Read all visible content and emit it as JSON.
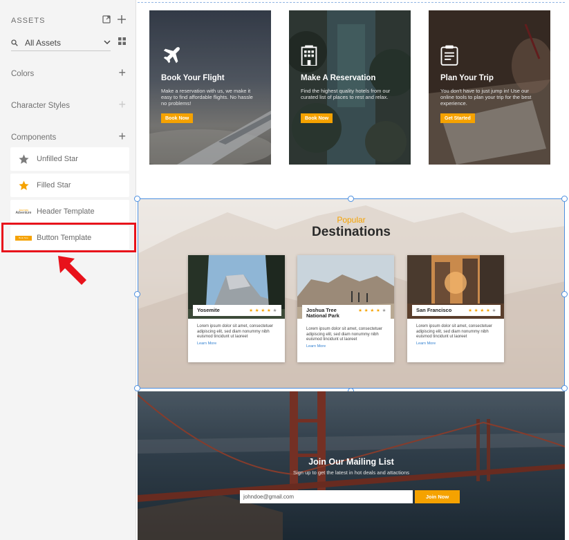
{
  "sidebar": {
    "header": "ASSETS",
    "search_label": "All Assets",
    "sections": {
      "colors": "Colors",
      "character_styles": "Character Styles",
      "components": "Components"
    },
    "components": [
      {
        "label": "Unfilled Star",
        "icon": "star-outline-icon"
      },
      {
        "label": "Filled Star",
        "icon": "star-filled-icon"
      },
      {
        "label": "Header Template",
        "icon": "header-thumbnail"
      },
      {
        "label": "Button Template",
        "icon": "button-thumbnail"
      }
    ],
    "mini_header_text": {
      "top": "Journey",
      "main": "Adventure"
    },
    "mini_button_text": "Book Now"
  },
  "hero_cards": [
    {
      "title": "Book Your Flight",
      "desc": "Make a reservation with us, we make it easy to find affordable flights. No hassle no problems!",
      "button": "Book Now",
      "icon": "airplane-icon"
    },
    {
      "title": "Make A Reservation",
      "desc": "Find the highest quality hotels from our curated list of places to rest and relax.",
      "button": "Book Now",
      "icon": "hotel-icon"
    },
    {
      "title": "Plan Your Trip",
      "desc": "You don't have to just jump in! Use our online tools to plan your trip for the best experience.",
      "button": "Get Started",
      "icon": "clipboard-icon"
    }
  ],
  "destinations": {
    "kicker": "Popular",
    "title": "Destinations",
    "cards": [
      {
        "name": "Yosemite",
        "stars": "★ ★ ★ ★ ",
        "star_off": "★",
        "desc": "Lorem ipsum dolor sit amet, consectetuer adipiscing elit, sed diam nonummy nibh euismod tincidunt ut laoreet",
        "link": "Learn More"
      },
      {
        "name": "Joshua Tree National Park",
        "stars": "★ ★ ★ ★ ",
        "star_off": "★",
        "desc": "Lorem ipsum dolor sit amet, consectetuer adipiscing elit, sed diam nonummy nibh euismod tincidunt ut laoreet",
        "link": "Learn More"
      },
      {
        "name": "San Francisco",
        "stars": "★ ★ ★ ★ ",
        "star_off": "★",
        "desc": "Lorem ipsum dolor sit amet, consectetuer adipiscing elit, sed diam nonummy nibh euismod tincidunt ut laoreet",
        "link": "Learn More"
      }
    ]
  },
  "mailing": {
    "title": "Join Our Mailing List",
    "subtitle": "Sign up to get the latest in hot deals and attactions",
    "email_value": "johndoe@gmail.com",
    "button": "Join Now"
  },
  "colors": {
    "accent": "#f5a200",
    "selection": "#4a8ee0",
    "highlight": "#e8121b"
  }
}
